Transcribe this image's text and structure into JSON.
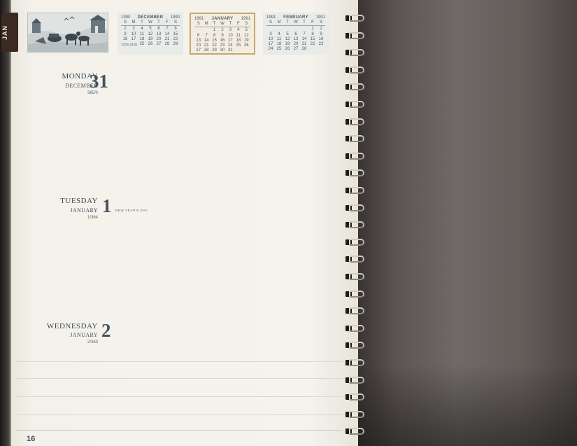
{
  "tab": {
    "label": "JAN"
  },
  "mini_calendars": [
    {
      "year_left": "1990",
      "month": "DECEMBER",
      "year_right": "1990",
      "dow": [
        "S",
        "M",
        "T",
        "W",
        "T",
        "F",
        "S"
      ],
      "weeks": [
        [
          "",
          "",
          "",
          "",
          "",
          "",
          ""
        ],
        [
          "2",
          "3",
          "4",
          "5",
          "6",
          "7",
          "8"
        ],
        [
          "9",
          "10",
          "11",
          "12",
          "13",
          "14",
          "15"
        ],
        [
          "16",
          "17",
          "18",
          "19",
          "20",
          "21",
          "22"
        ],
        [
          "23/30",
          "24/31",
          "25",
          "26",
          "27",
          "28",
          "29"
        ]
      ],
      "highlight": false
    },
    {
      "year_left": "1991",
      "month": "JANUARY",
      "year_right": "1991",
      "dow": [
        "S",
        "M",
        "T",
        "W",
        "T",
        "F",
        "S"
      ],
      "weeks": [
        [
          "",
          "",
          "1",
          "2",
          "3",
          "4",
          "5"
        ],
        [
          "6",
          "7",
          "8",
          "9",
          "10",
          "11",
          "12"
        ],
        [
          "13",
          "14",
          "15",
          "16",
          "17",
          "18",
          "19"
        ],
        [
          "20",
          "21",
          "22",
          "23",
          "24",
          "25",
          "26"
        ],
        [
          "27",
          "28",
          "29",
          "30",
          "31",
          "",
          ""
        ]
      ],
      "highlight": true
    },
    {
      "year_left": "1991",
      "month": "FEBRUARY",
      "year_right": "1991",
      "dow": [
        "S",
        "M",
        "T",
        "W",
        "T",
        "F",
        "S"
      ],
      "weeks": [
        [
          "",
          "",
          "",
          "",
          "",
          "1",
          "2"
        ],
        [
          "3",
          "4",
          "5",
          "6",
          "7",
          "8",
          "9"
        ],
        [
          "10",
          "11",
          "12",
          "13",
          "14",
          "15",
          "16"
        ],
        [
          "17",
          "18",
          "19",
          "20",
          "21",
          "22",
          "23"
        ],
        [
          "24",
          "25",
          "26",
          "27",
          "28",
          "",
          ""
        ]
      ],
      "highlight": false
    }
  ],
  "days": [
    {
      "weekday": "MONDAY",
      "month": "DECEMBER",
      "count": "365/0",
      "number": "31",
      "holiday": ""
    },
    {
      "weekday": "TUESDAY",
      "month": "JANUARY",
      "count": "1/364",
      "number": "1",
      "holiday": "NEW YEAR'S DAY"
    },
    {
      "weekday": "WEDNESDAY",
      "month": "JANUARY",
      "count": "2/363",
      "number": "2",
      "holiday": ""
    }
  ],
  "page_number": "16"
}
